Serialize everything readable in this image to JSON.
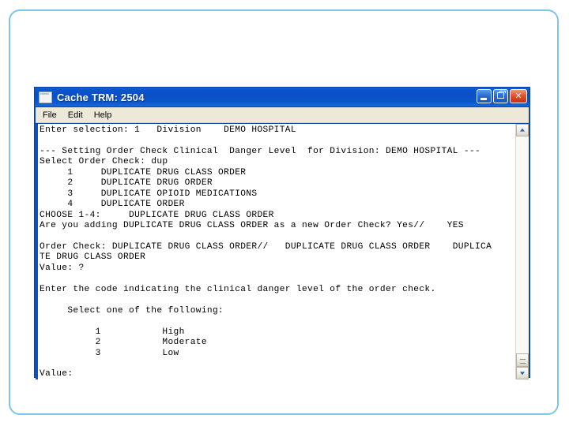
{
  "window": {
    "title": "Cache TRM: 2504",
    "icon": "terminal-window-icon",
    "buttons": {
      "minimize": "minimize-button",
      "restore": "restore-button",
      "close": "✕"
    },
    "menu": [
      "File",
      "Edit",
      "Help"
    ]
  },
  "terminal": {
    "lines": [
      "Enter selection: 1   Division    DEMO HOSPITAL",
      "",
      "--- Setting Order Check Clinical  Danger Level  for Division: DEMO HOSPITAL ---",
      "Select Order Check: dup",
      "     1     DUPLICATE DRUG CLASS ORDER",
      "     2     DUPLICATE DRUG ORDER",
      "     3     DUPLICATE OPIOID MEDICATIONS",
      "     4     DUPLICATE ORDER",
      "CHOOSE 1-4:     DUPLICATE DRUG CLASS ORDER",
      "Are you adding DUPLICATE DRUG CLASS ORDER as a new Order Check? Yes//    YES",
      "",
      "Order Check: DUPLICATE DRUG CLASS ORDER//   DUPLICATE DRUG CLASS ORDER    DUPLICA",
      "TE DRUG CLASS ORDER",
      "Value: ?",
      "",
      "Enter the code indicating the clinical danger level of the order check.",
      "",
      "     Select one of the following:",
      "",
      "          1           High",
      "          2           Moderate",
      "          3           Low",
      "",
      "Value:"
    ],
    "full_text": "Enter selection: 1   Division    DEMO HOSPITAL\n\n--- Setting Order Check Clinical  Danger Level  for Division: DEMO HOSPITAL ---\nSelect Order Check: dup\n     1     DUPLICATE DRUG CLASS ORDER\n     2     DUPLICATE DRUG ORDER\n     3     DUPLICATE OPIOID MEDICATIONS\n     4     DUPLICATE ORDER\nCHOOSE 1-4:     DUPLICATE DRUG CLASS ORDER\nAre you adding DUPLICATE DRUG CLASS ORDER as a new Order Check? Yes//    YES\n\nOrder Check: DUPLICATE DRUG CLASS ORDER//   DUPLICATE DRUG CLASS ORDER    DUPLICA\nTE DRUG CLASS ORDER\nValue: ?\n\nEnter the code indicating the clinical danger level of the order check.\n\n     Select one of the following:\n\n          1           High\n          2           Moderate\n          3           Low\n\nValue:"
  },
  "scrollbar": {
    "up_arrow": "scroll-up",
    "down_arrow": "scroll-down"
  },
  "colors": {
    "titlebar": "#0a52c6",
    "slide_border": "#7ec5e8",
    "menubar": "#ece9d8",
    "terminal_bg": "#ffffff",
    "terminal_fg": "#000000",
    "close_button": "#c12f14"
  }
}
